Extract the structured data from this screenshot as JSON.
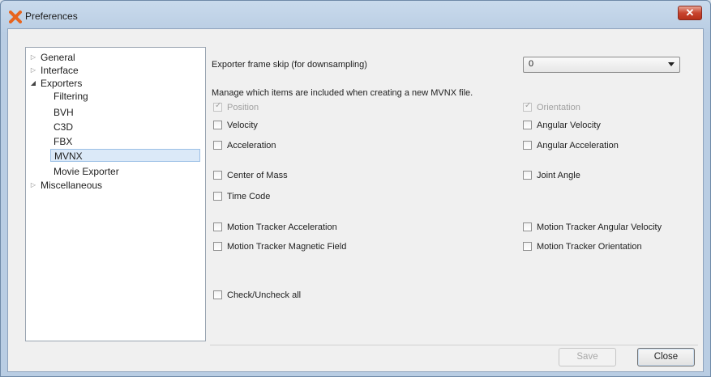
{
  "window": {
    "title": "Preferences",
    "icon": "app-x-icon",
    "close_icon": "close-x-icon",
    "accent_color": "#c8452f"
  },
  "tree": {
    "items": [
      {
        "label": "General",
        "expander": "collapsed"
      },
      {
        "label": "Interface",
        "expander": "collapsed"
      },
      {
        "label": "Exporters",
        "expander": "expanded"
      },
      {
        "label": "Filtering"
      },
      {
        "label": "BVH"
      },
      {
        "label": "C3D"
      },
      {
        "label": "FBX"
      },
      {
        "label": "MVNX",
        "selected": true
      },
      {
        "label": "Movie Exporter"
      },
      {
        "label": "Miscellaneous",
        "expander": "collapsed"
      }
    ]
  },
  "panel": {
    "frame_skip_label": "Exporter frame skip (for downsampling)",
    "frame_skip_value": "0",
    "manage_label": "Manage which items are included when creating a new MVNX file.",
    "checkboxes": {
      "position": {
        "label": "Position",
        "checked": true,
        "disabled": true
      },
      "orientation": {
        "label": "Orientation",
        "checked": true,
        "disabled": true
      },
      "velocity": {
        "label": "Velocity",
        "checked": false
      },
      "angular_velocity": {
        "label": "Angular Velocity",
        "checked": false
      },
      "acceleration": {
        "label": "Acceleration",
        "checked": false
      },
      "angular_acceleration": {
        "label": "Angular Acceleration",
        "checked": false
      },
      "center_of_mass": {
        "label": "Center of Mass",
        "checked": false
      },
      "joint_angle": {
        "label": "Joint Angle",
        "checked": false
      },
      "time_code": {
        "label": "Time Code",
        "checked": false
      },
      "mt_acceleration": {
        "label": "Motion Tracker Acceleration",
        "checked": false
      },
      "mt_angular_velocity": {
        "label": "Motion Tracker Angular Velocity",
        "checked": false
      },
      "mt_magnetic_field": {
        "label": "Motion Tracker Magnetic Field",
        "checked": false
      },
      "mt_orientation": {
        "label": "Motion Tracker Orientation",
        "checked": false
      },
      "check_all": {
        "label": "Check/Uncheck all",
        "checked": false
      }
    }
  },
  "footer": {
    "save_label": "Save",
    "close_label": "Close"
  }
}
